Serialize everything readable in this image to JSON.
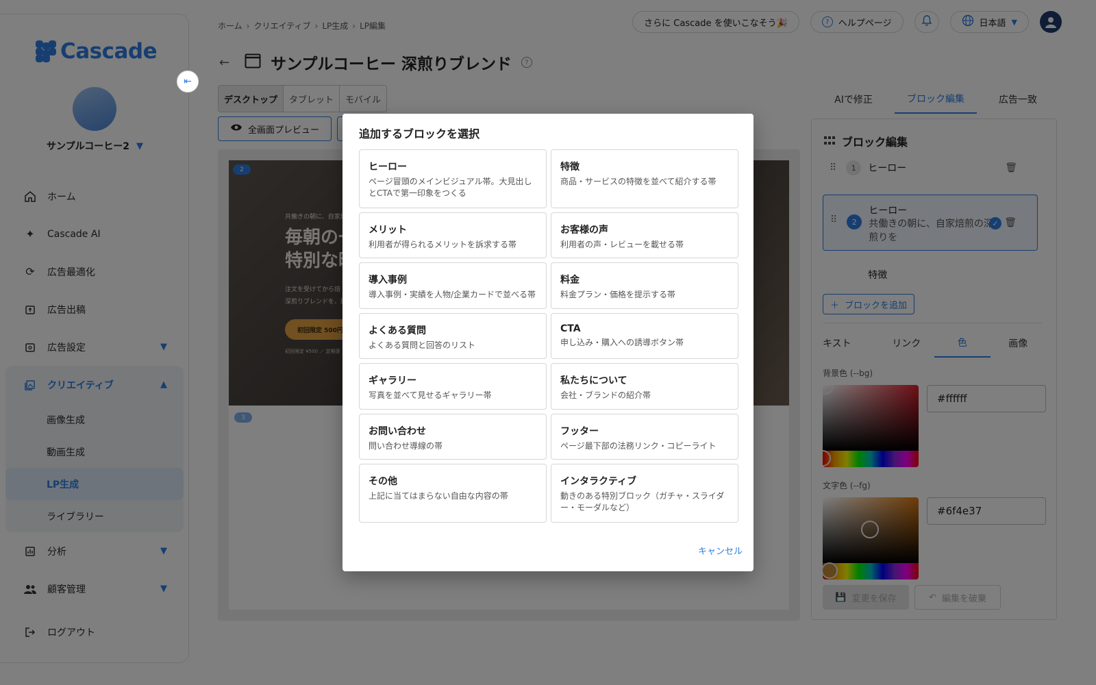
{
  "sidebar": {
    "logo_text": "Cascade",
    "account_name": "サンプルコーヒー2",
    "nav": [
      {
        "label": "ホーム",
        "icon": "home-icon"
      },
      {
        "label": "Cascade AI",
        "icon": "sparkle-icon"
      },
      {
        "label": "広告最適化",
        "icon": "sync-icon"
      },
      {
        "label": "広告出稿",
        "icon": "publish-icon"
      },
      {
        "label": "広告設定",
        "icon": "settings-icon"
      }
    ],
    "creative": {
      "label": "クリエイティブ",
      "sub": [
        "画像生成",
        "動画生成",
        "LP生成",
        "ライブラリー"
      ]
    },
    "nav_bottom": [
      {
        "label": "分析",
        "icon": "chart-icon"
      },
      {
        "label": "顧客管理",
        "icon": "people-icon"
      },
      {
        "label": "ログアウト",
        "icon": "logout-icon"
      }
    ]
  },
  "header": {
    "breadcrumb": [
      "ホーム",
      "クリエイティブ",
      "LP生成",
      "LP編集"
    ],
    "promo_label": "さらに Cascade を使いこなそう🎉",
    "help_label": "ヘルプページ",
    "language": "日本語"
  },
  "editor": {
    "title": "サンプルコーヒー 深煎りブレンド",
    "device_tabs": [
      "デスクトップ",
      "タブレット",
      "モバイル"
    ],
    "fullscreen_preview": "全画面プレビュー"
  },
  "preview": {
    "hero_tag": "共働きの朝に、自家焙",
    "hero_heading_1": "毎朝の一",
    "hero_heading_2": "特別な時",
    "hero_p1": "注文を受けてから焙",
    "hero_p2": "深煎りブレンドを、届",
    "hero_cta": "初回限定 500円",
    "hero_note": "初回限定 ¥500 ／ 定期便",
    "badge_2": "2",
    "badge_3": "3"
  },
  "right_panel": {
    "tabs": [
      "AIで修正",
      "ブロック編集",
      "広告一致"
    ],
    "title": "ブロック編集",
    "blocks": [
      {
        "num": "1",
        "label": "ヒーロー"
      },
      {
        "num": "2",
        "label": "ヒーロー",
        "sub": "共働きの朝に、自家焙煎の深煎りを"
      },
      {
        "num": "3",
        "label": "特徴"
      }
    ],
    "add_block": "ブロックを追加",
    "prop_tabs": [
      "キスト",
      "リンク",
      "色",
      "画像"
    ],
    "bg_label": "背景色 (--bg)",
    "bg_value": "#ffffff",
    "fg_label": "文字色 (--fg)",
    "fg_value": "#6f4e37",
    "save": "変更を保存",
    "discard": "編集を破棄"
  },
  "modal": {
    "title": "追加するブロックを選択",
    "options": [
      {
        "title": "ヒーロー",
        "desc": "ページ冒頭のメインビジュアル帯。大見出しとCTAで第一印象をつくる"
      },
      {
        "title": "特徴",
        "desc": "商品・サービスの特徴を並べて紹介する帯"
      },
      {
        "title": "メリット",
        "desc": "利用者が得られるメリットを訴求する帯"
      },
      {
        "title": "お客様の声",
        "desc": "利用者の声・レビューを載せる帯"
      },
      {
        "title": "導入事例",
        "desc": "導入事例・実績を人物/企業カードで並べる帯"
      },
      {
        "title": "料金",
        "desc": "料金プラン・価格を提示する帯"
      },
      {
        "title": "よくある質問",
        "desc": "よくある質問と回答のリスト"
      },
      {
        "title": "CTA",
        "desc": "申し込み・購入への誘導ボタン帯"
      },
      {
        "title": "ギャラリー",
        "desc": "写真を並べて見せるギャラリー帯"
      },
      {
        "title": "私たちについて",
        "desc": "会社・ブランドの紹介帯"
      },
      {
        "title": "お問い合わせ",
        "desc": "問い合わせ導線の帯"
      },
      {
        "title": "フッター",
        "desc": "ページ最下部の法務リンク・コピーライト"
      },
      {
        "title": "その他",
        "desc": "上記に当てはまらない自由な内容の帯"
      },
      {
        "title": "インタラクティブ",
        "desc": "動きのある特別ブロック（ガチャ・スライダー・モーダルなど）"
      }
    ],
    "cancel": "キャンセル"
  },
  "colors": {
    "accent": "#2f7de1",
    "overlay": "rgba(0,0,0,0.5)"
  }
}
